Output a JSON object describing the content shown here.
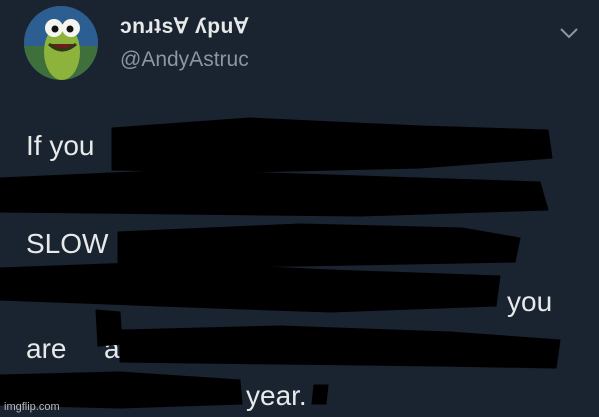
{
  "author": {
    "display_name": "ɔnɹʇs∀ ʎpu∀",
    "handle": "@AndyAstruc",
    "avatar_icon": "cartoon-fish-avatar",
    "menu_icon": "chevron-down-icon"
  },
  "body": {
    "fragments": [
      "If you",
      "SLOW",
      "you",
      "are",
      "a",
      "year."
    ]
  },
  "watermark": "imgflip.com",
  "colors": {
    "background": "#1a2330",
    "text": "#e7e9ea",
    "muted": "#8a96a3",
    "redaction": "#000000"
  }
}
